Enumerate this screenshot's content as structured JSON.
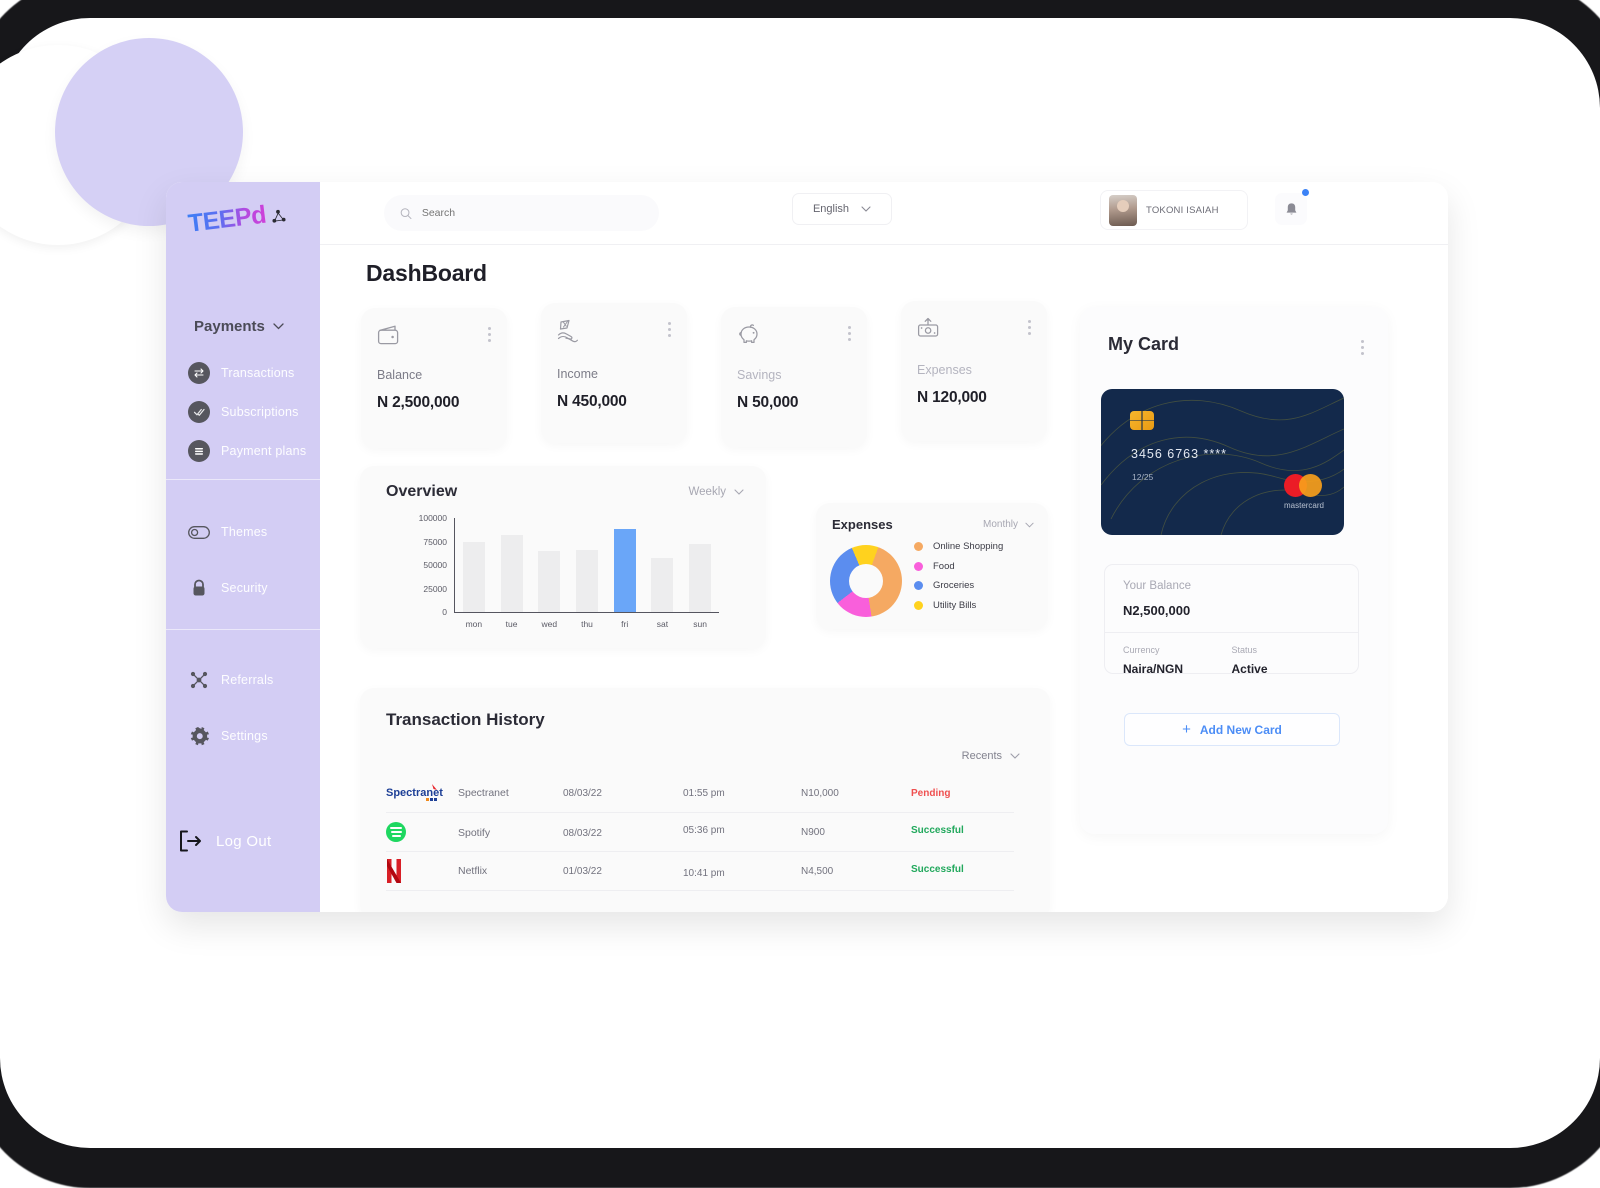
{
  "sidebar": {
    "logo_text": "TEEPd",
    "logo_mark_name": "teepd-node-mark",
    "payments_label": "Payments",
    "payments_items": [
      {
        "label": "Transactions",
        "icon": "exchange-icon"
      },
      {
        "label": "Subscriptions",
        "icon": "double-check-icon"
      },
      {
        "label": "Payment plans",
        "icon": "list-icon"
      }
    ],
    "prefs_items": [
      {
        "label": "Themes",
        "icon": "toggle-icon"
      },
      {
        "label": "Security",
        "icon": "lock-icon"
      }
    ],
    "other_items": [
      {
        "label": "Referrals",
        "icon": "referral-network-icon"
      },
      {
        "label": "Settings",
        "icon": "gear-icon"
      }
    ],
    "logout_label": "Log Out"
  },
  "header": {
    "search_placeholder": "Search",
    "search_value": "",
    "language": "English",
    "user_name": "TOKONI ISAIAH",
    "notification_dot_color": "#3b82f6"
  },
  "page_title": "DashBoard",
  "stats": [
    {
      "label": "Balance",
      "value": "N 2,500,000",
      "icon": "wallet-icon"
    },
    {
      "label": "Income",
      "value": "N 450,000",
      "icon": "hand-money-icon"
    },
    {
      "label": "Savings",
      "value": "N 50,000",
      "icon": "piggy-bank-icon"
    },
    {
      "label": "Expenses",
      "value": "N 120,000",
      "icon": "cash-out-icon"
    }
  ],
  "overview": {
    "title": "Overview",
    "period": "Weekly"
  },
  "expenses": {
    "title": "Expenses",
    "period": "Monthly"
  },
  "transactions": {
    "title": "Transaction History",
    "filter": "Recents",
    "rows": [
      {
        "logo": "spectranet-logo",
        "name": "Spectranet",
        "date": "08/03/22",
        "time": "01:55 pm",
        "amount": "N10,000",
        "status": "Pending",
        "status_color": "#ef4f4f"
      },
      {
        "logo": "spotify-logo",
        "name": "Spotify",
        "date": "08/03/22",
        "time": "05:36 pm",
        "amount": "N900",
        "status": "Successful",
        "status_color": "#21a85c"
      },
      {
        "logo": "netflix-logo",
        "name": "Netflix",
        "date": "01/03/22",
        "time": "10:41 pm",
        "amount": "N4,500",
        "status": "Successful",
        "status_color": "#21a85c"
      }
    ]
  },
  "my_card": {
    "title": "My Card",
    "card_number": "3456 6763 ****",
    "expiry": "12/25",
    "brand": "mastercard",
    "card_bg": "#13294b",
    "balance_label": "Your Balance",
    "balance_value": "N2,500,000",
    "currency_label": "Currency",
    "currency_value": "Naira/NGN",
    "status_label": "Status",
    "status_value": "Active",
    "add_card_label": "Add New Card",
    "add_card_plus": "+"
  },
  "chart_data": [
    {
      "type": "bar",
      "title": "Overview",
      "categories": [
        "mon",
        "tue",
        "wed",
        "thu",
        "fri",
        "sat",
        "sun"
      ],
      "values": [
        75000,
        82000,
        65000,
        66000,
        88000,
        57000,
        72000
      ],
      "highlight_index": 4,
      "highlight_color": "#6aa6f8",
      "bar_color": "#ededee",
      "yticks": [
        100000,
        75000,
        50000,
        25000,
        0
      ],
      "ylim": [
        0,
        100000
      ],
      "xlabel": "",
      "ylabel": "",
      "grid": false,
      "legend": "none"
    },
    {
      "type": "pie",
      "title": "Expenses",
      "donut": true,
      "labels": [
        "Online Shopping",
        "Food",
        "Groceries",
        "Utility Bills"
      ],
      "values": [
        42,
        17,
        29,
        12
      ],
      "colors": [
        "#f5a962",
        "#f95fdb",
        "#5b8def",
        "#ffd21e"
      ],
      "legend": "right"
    }
  ]
}
